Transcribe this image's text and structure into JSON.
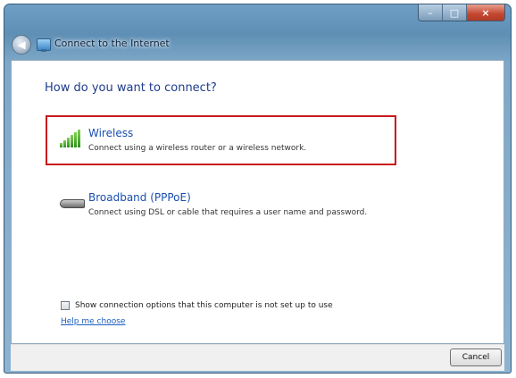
{
  "window": {
    "title": "Connect to the Internet",
    "controls": {
      "minimize": "–",
      "maximize": "□",
      "close": "×"
    }
  },
  "main": {
    "heading": "How do you want to connect?",
    "options": [
      {
        "title": "Wireless",
        "description": "Connect using a wireless router or a wireless network.",
        "icon": "signal-bars-icon",
        "selected": true
      },
      {
        "title": "Broadband (PPPoE)",
        "description": "Connect using DSL or cable that requires a user name and password.",
        "icon": "modem-icon",
        "selected": false
      }
    ],
    "show_options_label": "Show connection options that this computer is not set up to use",
    "show_options_checked": false,
    "help_link": "Help me choose"
  },
  "footer": {
    "cancel_label": "Cancel"
  },
  "colors": {
    "selection_border": "#c8171d",
    "heading": "#1e3b8c",
    "link": "#1a5fc0"
  }
}
